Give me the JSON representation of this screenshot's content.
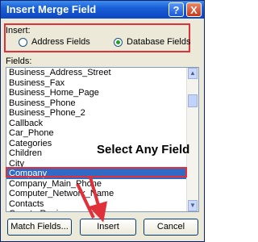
{
  "window": {
    "title": "Insert Merge Field",
    "help_glyph": "?",
    "close_glyph": "X"
  },
  "insert": {
    "label": "Insert:",
    "options": [
      {
        "label": "Address Fields",
        "selected": false
      },
      {
        "label": "Database Fields",
        "selected": true
      }
    ]
  },
  "fields": {
    "label": "Fields:",
    "items": [
      "Business_Address_Street",
      "Business_Fax",
      "Business_Home_Page",
      "Business_Phone",
      "Business_Phone_2",
      "Callback",
      "Car_Phone",
      "Categories",
      "Children",
      "City",
      "Company",
      "Company_Main_Phone",
      "Computer_Network_Name",
      "Contacts",
      "CountryRegion"
    ],
    "selected": "Company"
  },
  "annotation": {
    "text": "Select Any Field",
    "color": "#e0303a"
  },
  "buttons": {
    "match_fields": "Match Fields...",
    "insert": "Insert",
    "cancel": "Cancel"
  },
  "colors": {
    "selection": "#316ac5",
    "highlight": "#e0303a",
    "titlebar": "#0d46c1"
  }
}
